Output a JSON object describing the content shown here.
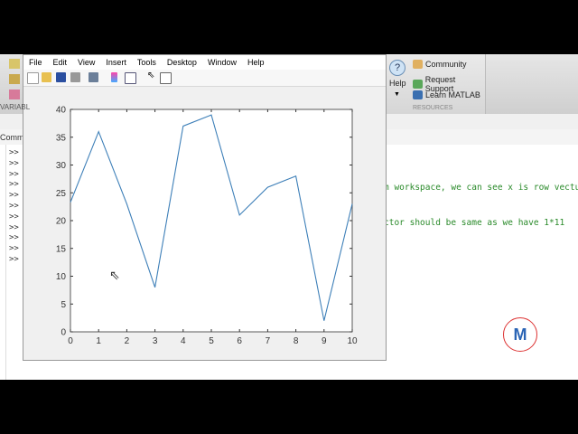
{
  "figure": {
    "menu": [
      "File",
      "Edit",
      "View",
      "Insert",
      "Tools",
      "Desktop",
      "Window",
      "Help"
    ]
  },
  "toolstrip": {
    "variable_label": "VARIABL",
    "help_label": "Help",
    "resources": {
      "items": [
        "Community",
        "Request Support",
        "Learn MATLAB"
      ],
      "section_label": "RESOURCES"
    }
  },
  "command_window": {
    "title": "Comma",
    "prompt": ">>",
    "lines": [
      "m workspace, we can see x is row vectu",
      "ctor should be same as we have 1*11"
    ]
  },
  "colors": {
    "line": "#3d7fb8",
    "comment": "#2a8a2a"
  },
  "chart_data": {
    "type": "line",
    "x": [
      0,
      1,
      2,
      3,
      4,
      5,
      6,
      7,
      8,
      9,
      10
    ],
    "y": [
      23.3,
      36,
      23,
      8,
      37,
      39,
      21,
      26,
      28,
      2,
      23
    ],
    "xlim": [
      0,
      10
    ],
    "ylim": [
      0,
      40
    ],
    "xticks": [
      "0",
      "1",
      "2",
      "3",
      "4",
      "5",
      "6",
      "7",
      "8",
      "9",
      "10"
    ],
    "yticks": [
      "0",
      "5",
      "10",
      "15",
      "20",
      "25",
      "30",
      "35",
      "40"
    ],
    "title": "",
    "xlabel": "",
    "ylabel": ""
  }
}
